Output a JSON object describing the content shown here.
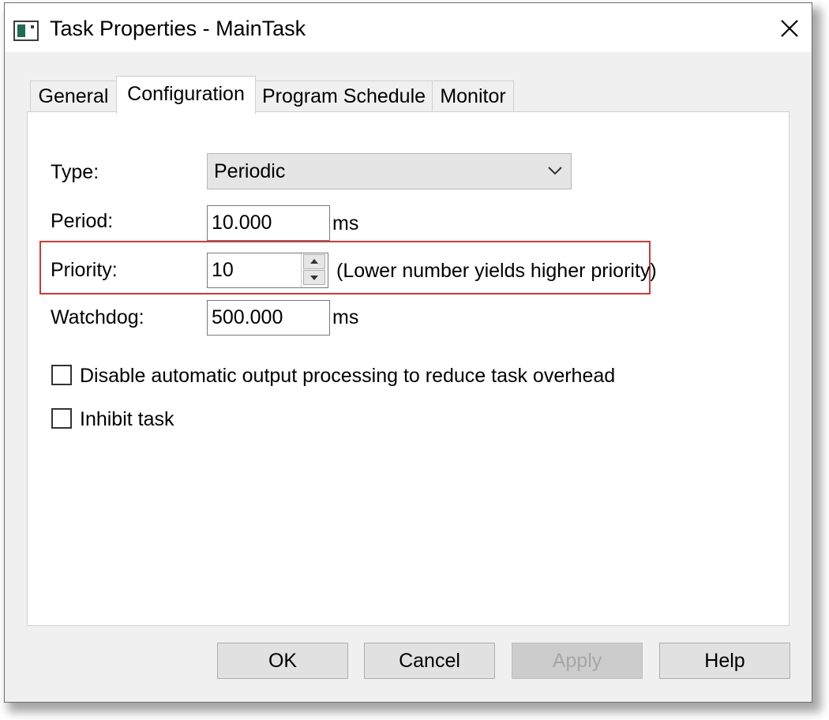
{
  "window": {
    "title": "Task Properties - MainTask",
    "icon": "task-window-icon",
    "close_icon": "close-icon"
  },
  "tabs": [
    {
      "label": "General",
      "active": false
    },
    {
      "label": "Configuration",
      "active": true
    },
    {
      "label": "Program Schedule",
      "active": false
    },
    {
      "label": "Monitor",
      "active": false
    }
  ],
  "config": {
    "type_label": "Type:",
    "type_value": "Periodic",
    "period_label": "Period:",
    "period_value": "10.000",
    "period_unit": "ms",
    "priority_label": "Priority:",
    "priority_value": "10",
    "priority_hint": "(Lower number yields higher priority)",
    "watchdog_label": "Watchdog:",
    "watchdog_value": "500.000",
    "watchdog_unit": "ms",
    "disable_output_label": "Disable automatic output processing to reduce task overhead",
    "disable_output_checked": false,
    "inhibit_label": "Inhibit task",
    "inhibit_checked": false,
    "highlight_color": "#cc3b3b"
  },
  "buttons": {
    "ok": "OK",
    "cancel": "Cancel",
    "apply": "Apply",
    "help": "Help"
  }
}
